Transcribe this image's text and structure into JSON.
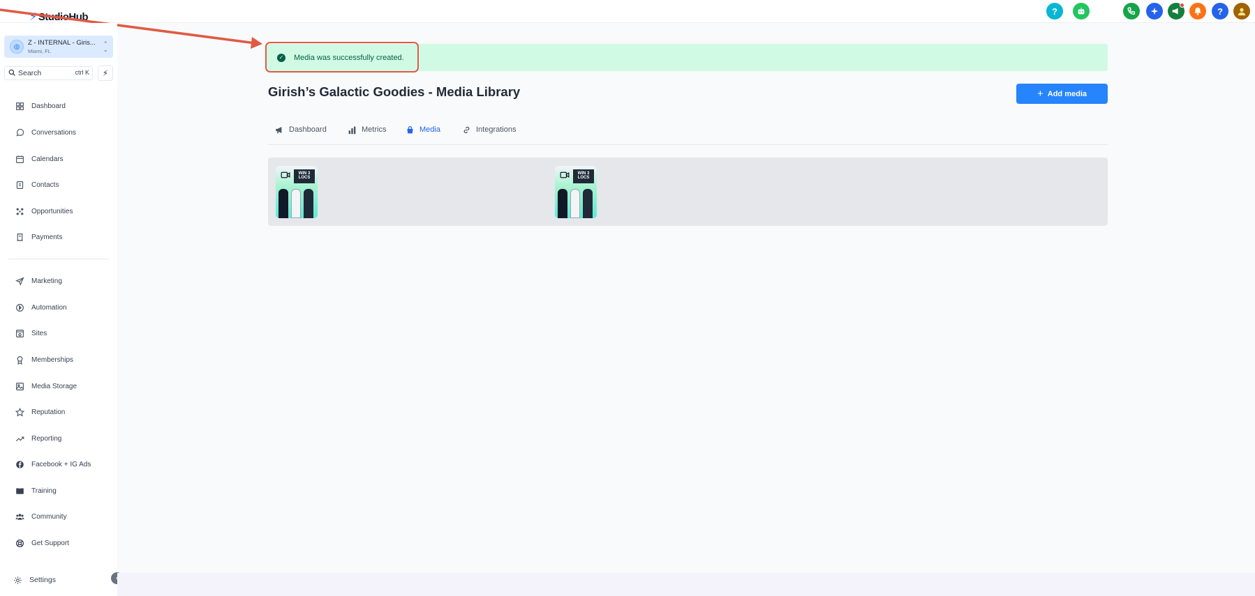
{
  "brand": {
    "logo_text": "StudioHub"
  },
  "topbar": {
    "icons": [
      {
        "name": "help-icon",
        "label": "?",
        "color": "#06b6d4"
      },
      {
        "name": "bot-icon",
        "label": "",
        "color": "#22c55e"
      },
      {
        "name": "phone-icon",
        "label": "",
        "color": "#16a34a"
      },
      {
        "name": "sparkle-icon",
        "label": "",
        "color": "#2563eb"
      },
      {
        "name": "megaphone-icon",
        "label": "",
        "color": "#15803d"
      },
      {
        "name": "bell-icon",
        "label": "",
        "color": "#f97316"
      },
      {
        "name": "question-icon",
        "label": "?",
        "color": "#2563eb"
      },
      {
        "name": "user-avatar",
        "label": "",
        "color": "#a16207"
      }
    ]
  },
  "sidebar": {
    "account": {
      "name": "Z - INTERNAL - Giris...",
      "location": "Miami, FL"
    },
    "search": {
      "placeholder": "Search",
      "shortcut": "ctrl K"
    },
    "items": [
      {
        "key": "dashboard",
        "label": "Dashboard",
        "icon": "grid-icon"
      },
      {
        "key": "conversations",
        "label": "Conversations",
        "icon": "chat-icon"
      },
      {
        "key": "calendars",
        "label": "Calendars",
        "icon": "calendar-icon"
      },
      {
        "key": "contacts",
        "label": "Contacts",
        "icon": "contacts-icon"
      },
      {
        "key": "opportunities",
        "label": "Opportunities",
        "icon": "opportunities-icon"
      },
      {
        "key": "payments",
        "label": "Payments",
        "icon": "receipt-icon"
      },
      {
        "key": "marketing",
        "label": "Marketing",
        "icon": "send-icon"
      },
      {
        "key": "automation",
        "label": "Automation",
        "icon": "automation-icon"
      },
      {
        "key": "sites",
        "label": "Sites",
        "icon": "sites-icon"
      },
      {
        "key": "memberships",
        "label": "Memberships",
        "icon": "award-icon"
      },
      {
        "key": "media-storage",
        "label": "Media Storage",
        "icon": "image-icon"
      },
      {
        "key": "reputation",
        "label": "Reputation",
        "icon": "star-icon"
      },
      {
        "key": "reporting",
        "label": "Reporting",
        "icon": "trend-icon"
      },
      {
        "key": "facebook-ig-ads",
        "label": "Facebook + IG Ads",
        "icon": "facebook-icon"
      },
      {
        "key": "training",
        "label": "Training",
        "icon": "book-icon"
      },
      {
        "key": "community",
        "label": "Community",
        "icon": "users-icon"
      },
      {
        "key": "get-support",
        "label": "Get Support",
        "icon": "lifebuoy-icon"
      }
    ],
    "settings_label": "Settings"
  },
  "toast": {
    "message": "Media was successfully created.",
    "color": "#d1fae5"
  },
  "page": {
    "title": "Girish’s Galactic Goodies - Media Library",
    "add_button": "Add media",
    "accent": "#2684fc"
  },
  "tabs": [
    {
      "label": "Dashboard",
      "icon": "megaphone-icon",
      "active": false
    },
    {
      "label": "Metrics",
      "icon": "bar-chart-icon",
      "active": false
    },
    {
      "label": "Media",
      "icon": "bag-icon",
      "active": true
    },
    {
      "label": "Integrations",
      "icon": "link-icon",
      "active": false
    }
  ],
  "media": [
    {
      "type": "video",
      "caption": "WIN 3 LOCS"
    },
    {
      "type": "video",
      "caption": "WIN 3 LOCS"
    }
  ]
}
